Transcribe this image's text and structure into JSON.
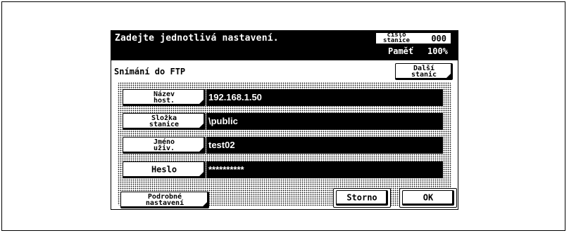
{
  "header": {
    "message": "Zadejte jednotlivá nastavení.",
    "station_label": "číslo\nstanice",
    "station_value": "000",
    "memory_label": "Paměť",
    "memory_value": "100%"
  },
  "panel": {
    "title": "Snímání do FTP",
    "next_station_label": "Další\nstanic"
  },
  "fields": [
    {
      "label": "Název\nhost.",
      "value": "192.168.1.50"
    },
    {
      "label": "Složka\nstanice",
      "value": "\\public"
    },
    {
      "label": "Jméno\nuživ.",
      "value": "test02"
    },
    {
      "label": "Heslo",
      "value": "**********"
    }
  ],
  "footer": {
    "details_label": "Podrobné\nnastavení",
    "cancel_label": "Storno",
    "ok_label": "OK"
  }
}
